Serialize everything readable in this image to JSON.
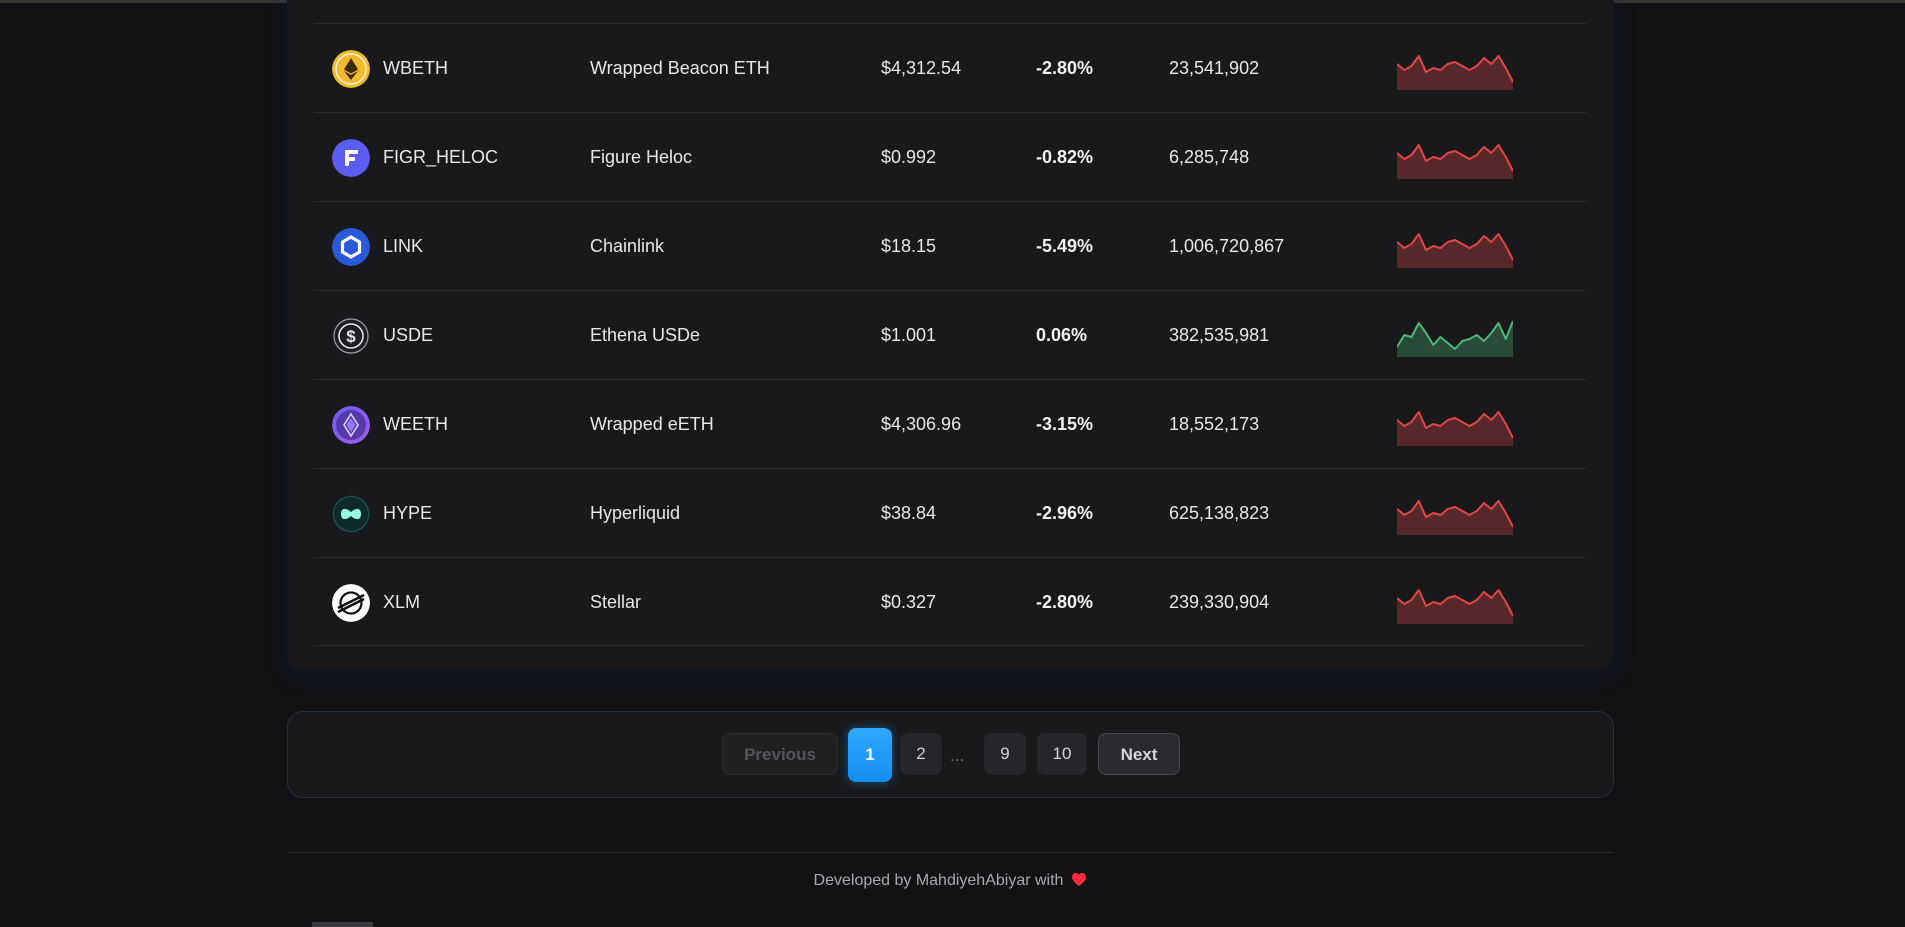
{
  "colors": {
    "negative_trend": "#e04848",
    "positive_trend": "#4fb878",
    "active_page": "#1e9bff",
    "heart": "#ff2b3d"
  },
  "table": {
    "rows": [
      {
        "symbol": "WBETH",
        "name": "Wrapped Beacon ETH",
        "price": "$4,312.54",
        "change": "-2.80%",
        "volume": "23,541,902",
        "icon": "wbeth-icon",
        "trend": "down"
      },
      {
        "symbol": "FIGR_HELOC",
        "name": "Figure Heloc",
        "price": "$0.992",
        "change": "-0.82%",
        "volume": "6,285,748",
        "icon": "figr-heloc-icon",
        "trend": "down"
      },
      {
        "symbol": "LINK",
        "name": "Chainlink",
        "price": "$18.15",
        "change": "-5.49%",
        "volume": "1,006,720,867",
        "icon": "chainlink-icon",
        "trend": "down"
      },
      {
        "symbol": "USDE",
        "name": "Ethena USDe",
        "price": "$1.001",
        "change": "0.06%",
        "volume": "382,535,981",
        "icon": "usde-icon",
        "trend": "up"
      },
      {
        "symbol": "WEETH",
        "name": "Wrapped eETH",
        "price": "$4,306.96",
        "change": "-3.15%",
        "volume": "18,552,173",
        "icon": "weeth-icon",
        "trend": "down"
      },
      {
        "symbol": "HYPE",
        "name": "Hyperliquid",
        "price": "$38.84",
        "change": "-2.96%",
        "volume": "625,138,823",
        "icon": "hyperliquid-icon",
        "trend": "down"
      },
      {
        "symbol": "XLM",
        "name": "Stellar",
        "price": "$0.327",
        "change": "-2.80%",
        "volume": "239,330,904",
        "icon": "stellar-icon",
        "trend": "down"
      }
    ]
  },
  "pagination": {
    "previous_label": "Previous",
    "pages": [
      "1",
      "2",
      "9",
      "10"
    ],
    "ellipsis": "...",
    "current_page": "1",
    "next_label": "Next"
  },
  "footer": {
    "text": "Developed by MahdiyehAbiyar with",
    "heart_icon": "heart-icon"
  }
}
